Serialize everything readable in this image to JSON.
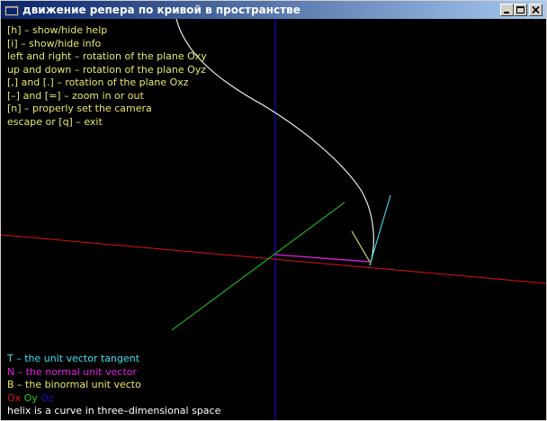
{
  "window": {
    "title": "движение репера по кривой в пространстве",
    "controls": [
      "minimize",
      "maximize",
      "close"
    ]
  },
  "help": {
    "lines": [
      "[h] – show/hide help",
      "[i] – show/hide info",
      "left and right – rotation of the plane Oxy",
      "up and down – rotation of the plane Oyz",
      "[,] and [.] – rotation of the plane Oxz",
      "[–] and [=] – zoom in or out",
      "[n] – properly set the camera",
      "escape or [q] – exit"
    ],
    "color": "#e8e86a"
  },
  "info": {
    "tangent": "T – the unit vector tangent",
    "normal": "N – the normal unit vector",
    "binormal": "B – the binormal unit vecto",
    "axis_x": "Ox",
    "axis_y": "Oy",
    "axis_z": "Oz",
    "caption": "helix is a curve in three–dimensional space"
  },
  "colors": {
    "axis_x": "#e01010",
    "axis_y": "#20d020",
    "axis_z": "#1010c0",
    "tangent": "#40e0f0",
    "normal": "#e020e0",
    "binormal": "#e8e86a",
    "curve": "#ffffff",
    "caption": "#ffffff"
  }
}
